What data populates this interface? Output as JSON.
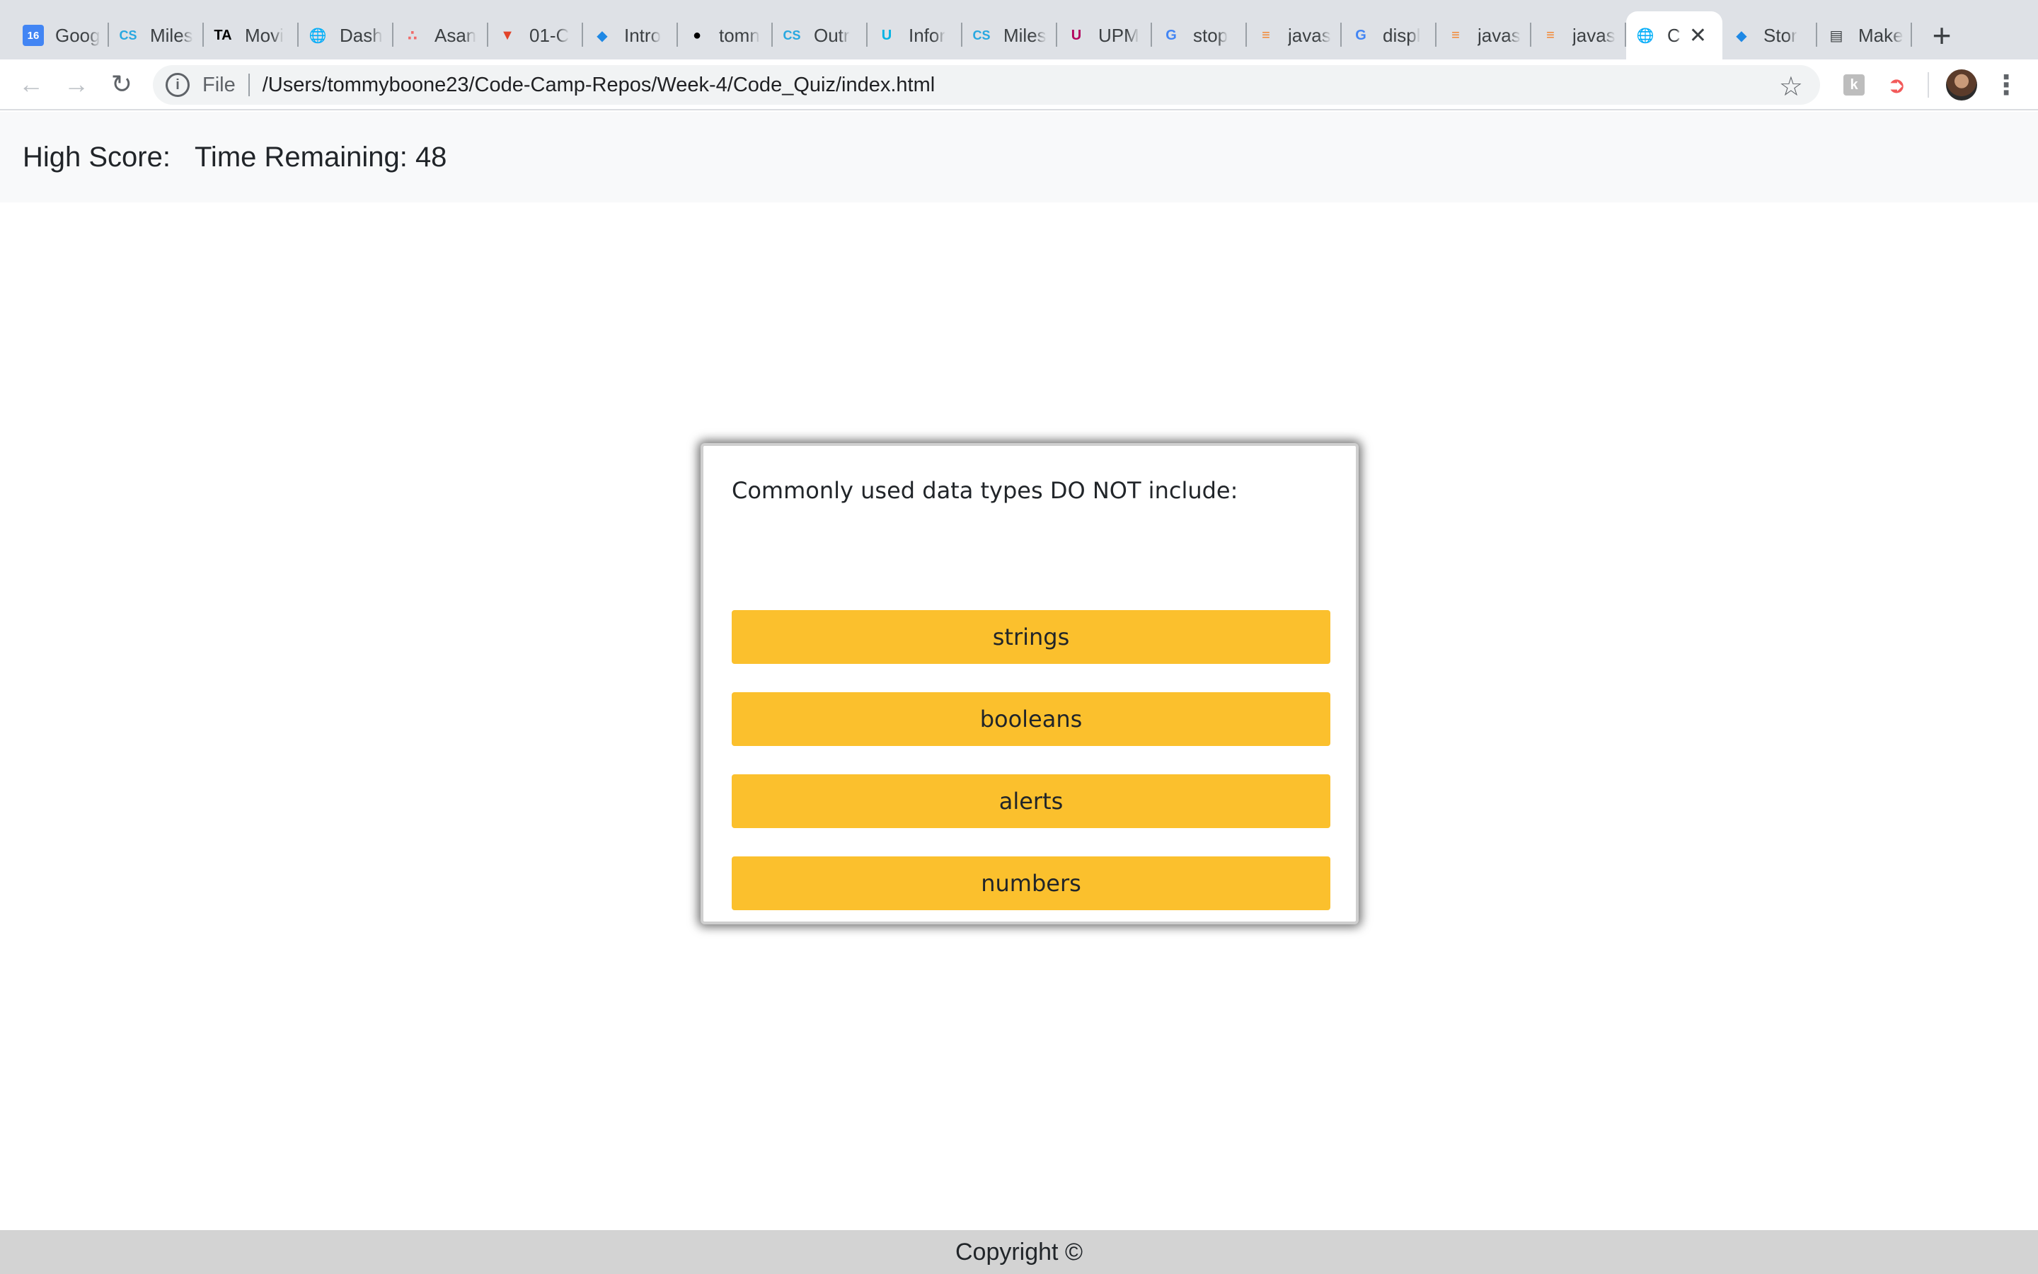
{
  "browser": {
    "tabs": [
      {
        "title": "Goog",
        "favicon": "google-calendar-icon",
        "color": "#4285f4"
      },
      {
        "title": "Miles",
        "favicon": "cs-icon",
        "color": "#29a8e0"
      },
      {
        "title": "Movi",
        "favicon": "ta-icon",
        "color": "#000000"
      },
      {
        "title": "Dash",
        "favicon": "globe-icon",
        "color": "#5f6368"
      },
      {
        "title": "Asan",
        "favicon": "asana-icon",
        "color": "#f06a6a"
      },
      {
        "title": "01-C",
        "favicon": "gitlab-icon",
        "color": "#e24329"
      },
      {
        "title": "Intro",
        "favicon": "panther-icon",
        "color": "#1e88e5"
      },
      {
        "title": "tomn",
        "favicon": "github-icon",
        "color": "#000000"
      },
      {
        "title": "Outr",
        "favicon": "cs-icon",
        "color": "#29a8e0"
      },
      {
        "title": "Infor",
        "favicon": "udacity-icon",
        "color": "#02b3e4"
      },
      {
        "title": "Miles",
        "favicon": "cs-icon",
        "color": "#29a8e0"
      },
      {
        "title": "UPM",
        "favicon": "upmc-icon",
        "color": "#b3005e"
      },
      {
        "title": "stop",
        "favicon": "google-icon",
        "color": "#4285f4"
      },
      {
        "title": "javas",
        "favicon": "stackoverflow-icon",
        "color": "#f48024"
      },
      {
        "title": "displ",
        "favicon": "google-icon",
        "color": "#4285f4"
      },
      {
        "title": "javas",
        "favicon": "stackoverflow-icon",
        "color": "#f48024"
      },
      {
        "title": "javas",
        "favicon": "stackoverflow-icon",
        "color": "#f48024"
      },
      {
        "title": "C",
        "favicon": "globe-icon",
        "color": "#5f6368",
        "active": true
      },
      {
        "title": "Stor",
        "favicon": "panther-icon",
        "color": "#1e88e5"
      },
      {
        "title": "Make",
        "favicon": "document-icon",
        "color": "#3c4043"
      }
    ],
    "new_tab_label": "+",
    "close_glyph": "✕",
    "address": {
      "scheme_label": "File",
      "url": "/Users/tommyboone23/Code-Camp-Repos/Week-4/Code_Quiz/index.html"
    }
  },
  "header": {
    "high_score_label": "High Score:",
    "time_label": "Time Remaining: 48"
  },
  "quiz": {
    "question": "Commonly used data types DO NOT include:",
    "answers": [
      "strings",
      "booleans",
      "alerts",
      "numbers"
    ],
    "button_color": "#fbc02d"
  },
  "footer": {
    "text": "Copyright ©"
  }
}
